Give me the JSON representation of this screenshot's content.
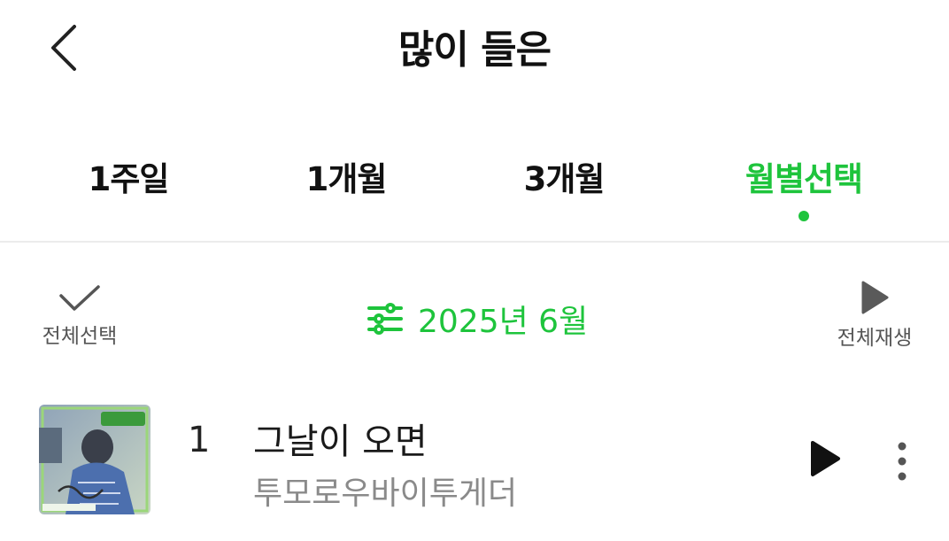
{
  "header": {
    "title": "많이 들은",
    "back_icon": "chevron-left-icon"
  },
  "tabs": [
    {
      "label": "1주일",
      "active": false
    },
    {
      "label": "1개월",
      "active": false
    },
    {
      "label": "3개월",
      "active": false
    },
    {
      "label": "월별선택",
      "active": true
    }
  ],
  "toolbar": {
    "select_all_label": "전체선택",
    "select_all_icon": "checkmark-icon",
    "month_label": "2025년 6월",
    "month_icon": "sliders-icon",
    "play_all_label": "전체재생",
    "play_all_icon": "play-icon"
  },
  "songs": [
    {
      "rank": "1",
      "title": "그날이 오면",
      "artist": "투모로우바이투게더",
      "cover_icon": "album-cover-image",
      "play_icon": "play-icon",
      "more_icon": "more-vertical-icon"
    }
  ],
  "colors": {
    "accent": "#1ec43c",
    "text_primary": "#111111",
    "text_secondary": "#8a8a8a",
    "divider": "#ececec"
  }
}
